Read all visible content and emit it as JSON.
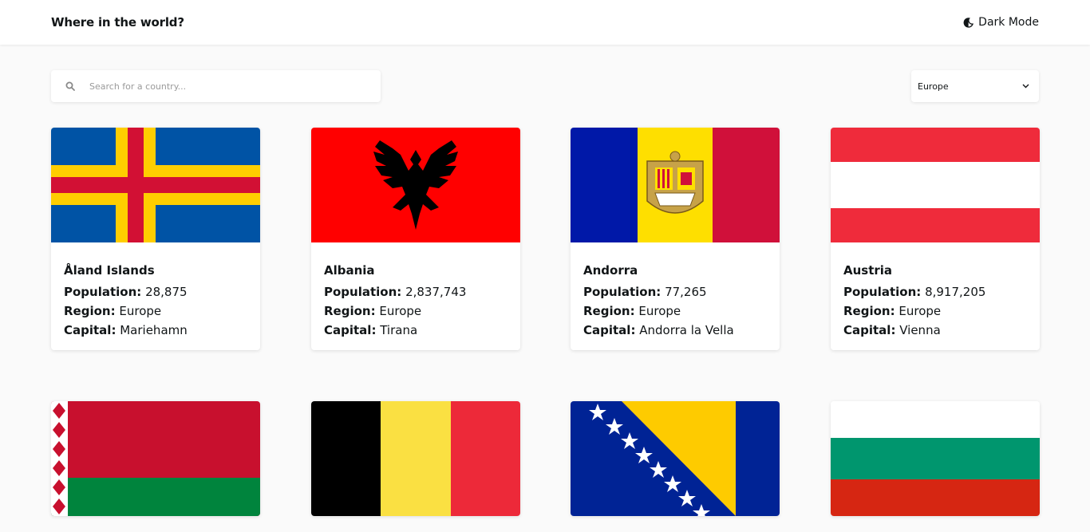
{
  "header": {
    "title": "Where in the world?",
    "dark_mode_label": "Dark Mode"
  },
  "search": {
    "placeholder": "Search for a country..."
  },
  "filter": {
    "selected": "Europe"
  },
  "labels": {
    "population": "Population:",
    "region": "Region:",
    "capital": "Capital:"
  },
  "countries": [
    {
      "name": "Åland Islands",
      "population": "28,875",
      "region": "Europe",
      "capital": "Mariehamn"
    },
    {
      "name": "Albania",
      "population": "2,837,743",
      "region": "Europe",
      "capital": "Tirana"
    },
    {
      "name": "Andorra",
      "population": "77,265",
      "region": "Europe",
      "capital": "Andorra la Vella"
    },
    {
      "name": "Austria",
      "population": "8,917,205",
      "region": "Europe",
      "capital": "Vienna"
    }
  ],
  "colors": {
    "background": "#fafafa",
    "card": "#ffffff",
    "text": "#111517"
  }
}
